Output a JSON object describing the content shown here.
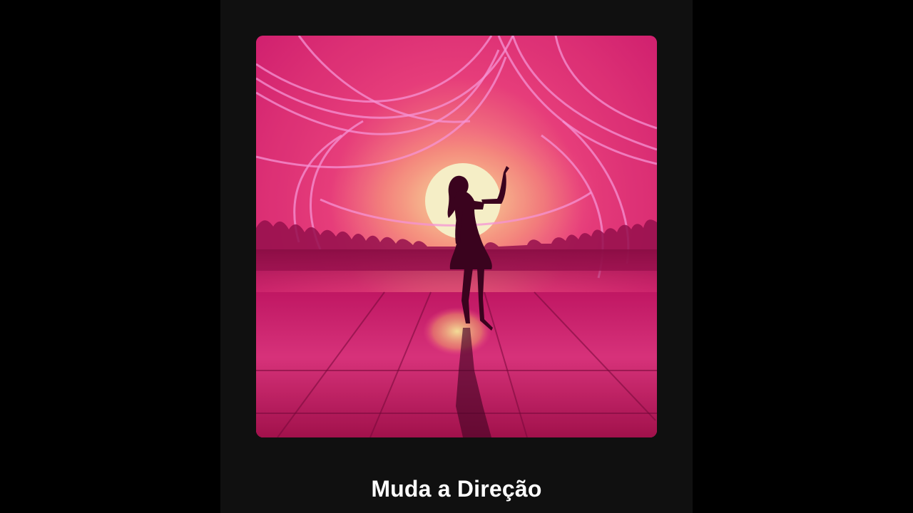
{
  "track": {
    "title": "Muda a Direção"
  },
  "artwork": {
    "subject": "dancer-silhouette",
    "colors": {
      "background": "#000000",
      "panel": "#101010",
      "sky_top": "#e9317f",
      "sky_mid": "#ff4f84",
      "glow": "#ffb36b",
      "sun": "#fff7c4",
      "floor": "#b3155c",
      "silhouette": "#3d0420",
      "ribbon": "#ff8fd8"
    }
  }
}
